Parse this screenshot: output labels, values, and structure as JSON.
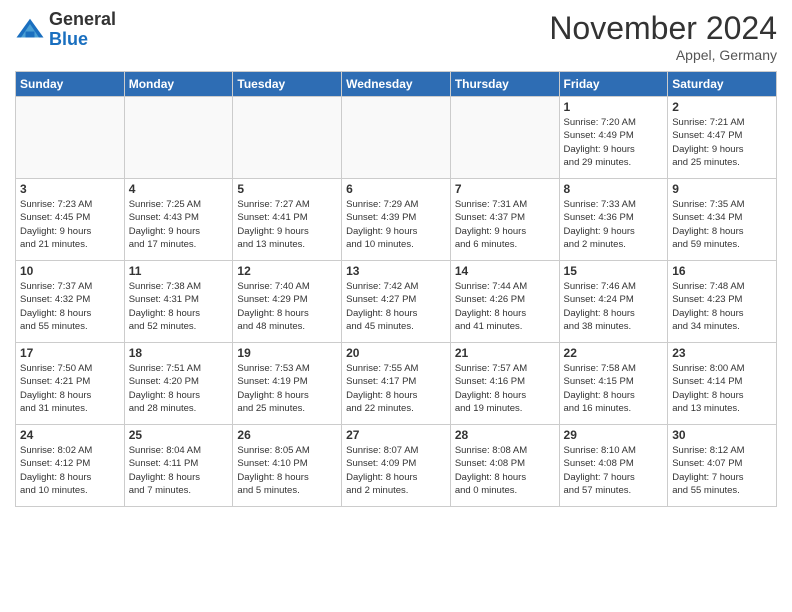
{
  "header": {
    "logo_general": "General",
    "logo_blue": "Blue",
    "month_title": "November 2024",
    "location": "Appel, Germany"
  },
  "weekdays": [
    "Sunday",
    "Monday",
    "Tuesday",
    "Wednesday",
    "Thursday",
    "Friday",
    "Saturday"
  ],
  "weeks": [
    [
      {
        "day": "",
        "info": ""
      },
      {
        "day": "",
        "info": ""
      },
      {
        "day": "",
        "info": ""
      },
      {
        "day": "",
        "info": ""
      },
      {
        "day": "",
        "info": ""
      },
      {
        "day": "1",
        "info": "Sunrise: 7:20 AM\nSunset: 4:49 PM\nDaylight: 9 hours\nand 29 minutes."
      },
      {
        "day": "2",
        "info": "Sunrise: 7:21 AM\nSunset: 4:47 PM\nDaylight: 9 hours\nand 25 minutes."
      }
    ],
    [
      {
        "day": "3",
        "info": "Sunrise: 7:23 AM\nSunset: 4:45 PM\nDaylight: 9 hours\nand 21 minutes."
      },
      {
        "day": "4",
        "info": "Sunrise: 7:25 AM\nSunset: 4:43 PM\nDaylight: 9 hours\nand 17 minutes."
      },
      {
        "day": "5",
        "info": "Sunrise: 7:27 AM\nSunset: 4:41 PM\nDaylight: 9 hours\nand 13 minutes."
      },
      {
        "day": "6",
        "info": "Sunrise: 7:29 AM\nSunset: 4:39 PM\nDaylight: 9 hours\nand 10 minutes."
      },
      {
        "day": "7",
        "info": "Sunrise: 7:31 AM\nSunset: 4:37 PM\nDaylight: 9 hours\nand 6 minutes."
      },
      {
        "day": "8",
        "info": "Sunrise: 7:33 AM\nSunset: 4:36 PM\nDaylight: 9 hours\nand 2 minutes."
      },
      {
        "day": "9",
        "info": "Sunrise: 7:35 AM\nSunset: 4:34 PM\nDaylight: 8 hours\nand 59 minutes."
      }
    ],
    [
      {
        "day": "10",
        "info": "Sunrise: 7:37 AM\nSunset: 4:32 PM\nDaylight: 8 hours\nand 55 minutes."
      },
      {
        "day": "11",
        "info": "Sunrise: 7:38 AM\nSunset: 4:31 PM\nDaylight: 8 hours\nand 52 minutes."
      },
      {
        "day": "12",
        "info": "Sunrise: 7:40 AM\nSunset: 4:29 PM\nDaylight: 8 hours\nand 48 minutes."
      },
      {
        "day": "13",
        "info": "Sunrise: 7:42 AM\nSunset: 4:27 PM\nDaylight: 8 hours\nand 45 minutes."
      },
      {
        "day": "14",
        "info": "Sunrise: 7:44 AM\nSunset: 4:26 PM\nDaylight: 8 hours\nand 41 minutes."
      },
      {
        "day": "15",
        "info": "Sunrise: 7:46 AM\nSunset: 4:24 PM\nDaylight: 8 hours\nand 38 minutes."
      },
      {
        "day": "16",
        "info": "Sunrise: 7:48 AM\nSunset: 4:23 PM\nDaylight: 8 hours\nand 34 minutes."
      }
    ],
    [
      {
        "day": "17",
        "info": "Sunrise: 7:50 AM\nSunset: 4:21 PM\nDaylight: 8 hours\nand 31 minutes."
      },
      {
        "day": "18",
        "info": "Sunrise: 7:51 AM\nSunset: 4:20 PM\nDaylight: 8 hours\nand 28 minutes."
      },
      {
        "day": "19",
        "info": "Sunrise: 7:53 AM\nSunset: 4:19 PM\nDaylight: 8 hours\nand 25 minutes."
      },
      {
        "day": "20",
        "info": "Sunrise: 7:55 AM\nSunset: 4:17 PM\nDaylight: 8 hours\nand 22 minutes."
      },
      {
        "day": "21",
        "info": "Sunrise: 7:57 AM\nSunset: 4:16 PM\nDaylight: 8 hours\nand 19 minutes."
      },
      {
        "day": "22",
        "info": "Sunrise: 7:58 AM\nSunset: 4:15 PM\nDaylight: 8 hours\nand 16 minutes."
      },
      {
        "day": "23",
        "info": "Sunrise: 8:00 AM\nSunset: 4:14 PM\nDaylight: 8 hours\nand 13 minutes."
      }
    ],
    [
      {
        "day": "24",
        "info": "Sunrise: 8:02 AM\nSunset: 4:12 PM\nDaylight: 8 hours\nand 10 minutes."
      },
      {
        "day": "25",
        "info": "Sunrise: 8:04 AM\nSunset: 4:11 PM\nDaylight: 8 hours\nand 7 minutes."
      },
      {
        "day": "26",
        "info": "Sunrise: 8:05 AM\nSunset: 4:10 PM\nDaylight: 8 hours\nand 5 minutes."
      },
      {
        "day": "27",
        "info": "Sunrise: 8:07 AM\nSunset: 4:09 PM\nDaylight: 8 hours\nand 2 minutes."
      },
      {
        "day": "28",
        "info": "Sunrise: 8:08 AM\nSunset: 4:08 PM\nDaylight: 8 hours\nand 0 minutes."
      },
      {
        "day": "29",
        "info": "Sunrise: 8:10 AM\nSunset: 4:08 PM\nDaylight: 7 hours\nand 57 minutes."
      },
      {
        "day": "30",
        "info": "Sunrise: 8:12 AM\nSunset: 4:07 PM\nDaylight: 7 hours\nand 55 minutes."
      }
    ]
  ]
}
